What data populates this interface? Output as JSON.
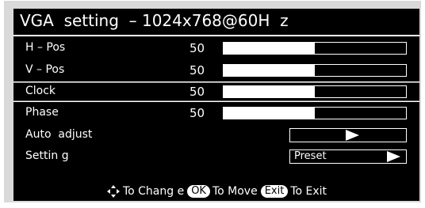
{
  "osd": {
    "title": "VGA  setting  – 1024x768@60H  z",
    "rows": [
      {
        "label": "H – Pos",
        "value": "50",
        "level": 0.5
      },
      {
        "label": "V – Pos",
        "value": "50",
        "level": 0.5
      },
      {
        "label": "Clock",
        "value": "50",
        "level": 0.5,
        "selected": true
      },
      {
        "label": "Phase",
        "value": "50",
        "level": 0.5
      }
    ],
    "auto_adjust": {
      "label": "Auto  adjust"
    },
    "setting": {
      "label": "Settin g",
      "option": "Preset"
    },
    "footer": {
      "change_text": "To  Chang e",
      "ok_key": "OK",
      "move_text": "To  Move",
      "exit_key": "Exit",
      "exit_text": "To  Exit"
    }
  },
  "colors": {
    "background": "#000000",
    "foreground": "#ffffff",
    "frame": "#d9d9d9"
  },
  "icons": [
    "four-way-arrow-icon",
    "play-arrow-icon"
  ]
}
